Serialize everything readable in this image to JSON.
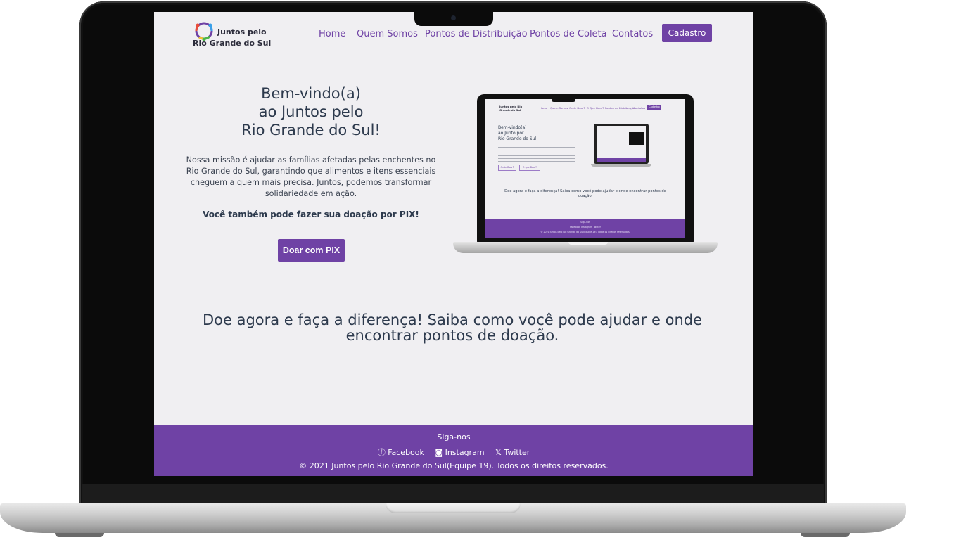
{
  "brand": {
    "line1": "Juntos pelo",
    "line2": "Rio Grande do Sul"
  },
  "nav": {
    "items": [
      "Home",
      "Quem Somos",
      "Pontos de Distribuição",
      "Pontos de Coleta",
      "Contatos"
    ],
    "cta": "Cadastro"
  },
  "hero": {
    "title_lines": [
      "Bem-vindo(a)",
      "ao Juntos pelo",
      "Rio Grande do Sul!"
    ],
    "text": "Nossa missão é ajudar as famílias afetadas pelas enchentes no Rio Grande do Sul, garantindo que alimentos e itens essenciais cheguem a quem mais precisa. Juntos, podemos transformar solidariedade em ação.",
    "pix_note": "Você também pode fazer sua doação por PIX!",
    "pix_button": "Doar com PIX"
  },
  "mockup": {
    "logo": "Juntos pelo Rio Grande do Sul",
    "nav": [
      "Home",
      "Quem Somos",
      "Onde Doar?",
      "O Que Doar?",
      "Pontos de Distribuição",
      "Contatos"
    ],
    "cta": "Cadastro",
    "title_lines": [
      "Bem-vindo(a)",
      "ao Junto por",
      "Rio Grande do Sul!"
    ],
    "buttons": [
      "Onde Doar?",
      "O que Doar?"
    ],
    "cta_text": "Doe agora e faça a diferença! Saiba como você pode ajudar e onde encontrar pontos de doação.",
    "footer_follow": "Siga-nos",
    "footer_links": "Facebook   Instagram   Twitter",
    "footer_copy": "© 2021 Juntos pelo Rio Grande do Sul(Equipe 19). Todos os direitos reservados."
  },
  "cta_text": "Doe agora e faça a diferença! Saiba como você pode ajudar e onde encontrar pontos de doação.",
  "footer": {
    "follow": "Siga-nos",
    "links": [
      {
        "icon": "facebook-icon",
        "glyph": "ⓕ",
        "label": "Facebook"
      },
      {
        "icon": "instagram-icon",
        "glyph": "◙",
        "label": "Instagram"
      },
      {
        "icon": "x-icon",
        "glyph": "𝕏",
        "label": "Twitter"
      }
    ],
    "copyright": "© 2021 Juntos pelo Rio Grande do Sul(Equipe 19). Todos os direitos reservados."
  },
  "colors": {
    "accent": "#6f42a5",
    "background": "#f0eff2",
    "text": "#2d3a4d"
  }
}
